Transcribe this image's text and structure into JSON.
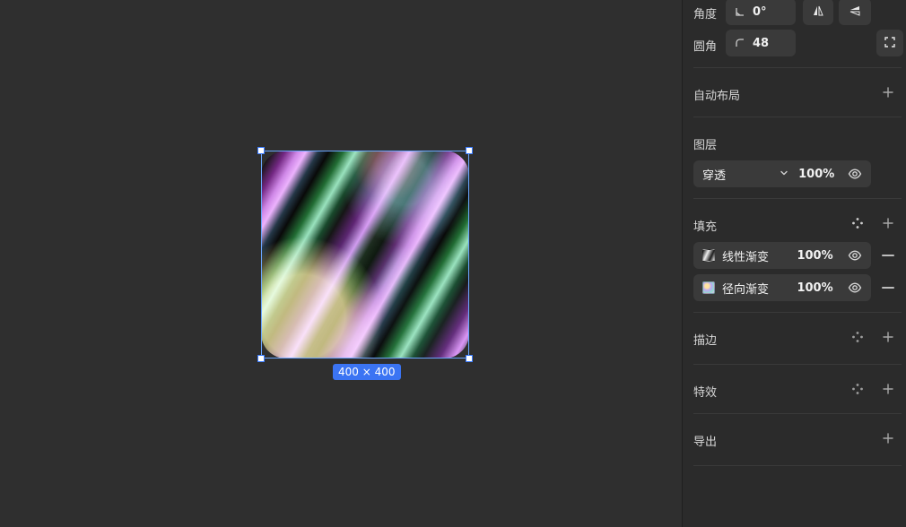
{
  "canvas": {
    "selection_size_label": "400 × 400"
  },
  "panel": {
    "angle": {
      "label": "角度",
      "value": "0°"
    },
    "radius": {
      "label": "圆角",
      "value": "48"
    },
    "auto_layout": {
      "title": "自动布局"
    },
    "layers": {
      "title": "图层",
      "blend_mode": "穿透",
      "opacity": "100%"
    },
    "fill": {
      "title": "填充",
      "items": [
        {
          "type_label": "线性渐变",
          "opacity": "100%"
        },
        {
          "type_label": "径向渐变",
          "opacity": "100%"
        }
      ]
    },
    "stroke": {
      "title": "描边"
    },
    "effects": {
      "title": "特效"
    },
    "export": {
      "title": "导出"
    }
  },
  "icons": {
    "angle": "angle-icon",
    "flip_h": "flip-horizontal-icon",
    "flip_v": "flip-vertical-icon",
    "corner": "corner-radius-icon",
    "expand": "expand-corners-icon",
    "plus": "plus-icon",
    "minus": "minus-icon",
    "eye": "eye-icon",
    "style": "style-dots-icon",
    "chevron": "chevron-down-icon"
  },
  "colors": {
    "canvas_bg": "#2f2f2f",
    "panel_bg": "#2b2b2b",
    "accent": "#3b74f3"
  }
}
